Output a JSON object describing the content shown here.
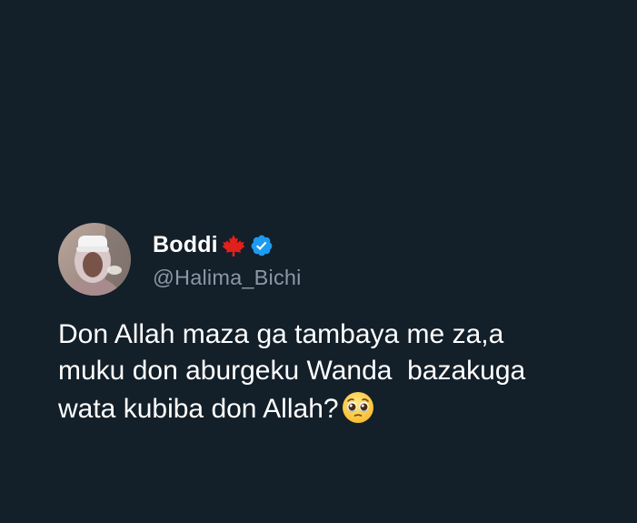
{
  "tweet": {
    "author": {
      "display_name": "Boddi",
      "flag_icon": "canada-maple-leaf-flag-icon",
      "verified_icon": "verified-badge-icon",
      "handle": "@Halima_Bichi"
    },
    "text_lines": [
      "Don Allah maza ga tambaya me za,a",
      "muku don aburgeku Wanda  bazakuga",
      "wata kubiba don Allah?"
    ],
    "trailing_emoji": "pleading-face-icon"
  },
  "colors": {
    "background": "#131f29",
    "text": "#ffffff",
    "handle": "#8b98a5",
    "verified_blue": "#1d9bf0",
    "flag_red": "#e0201d"
  }
}
